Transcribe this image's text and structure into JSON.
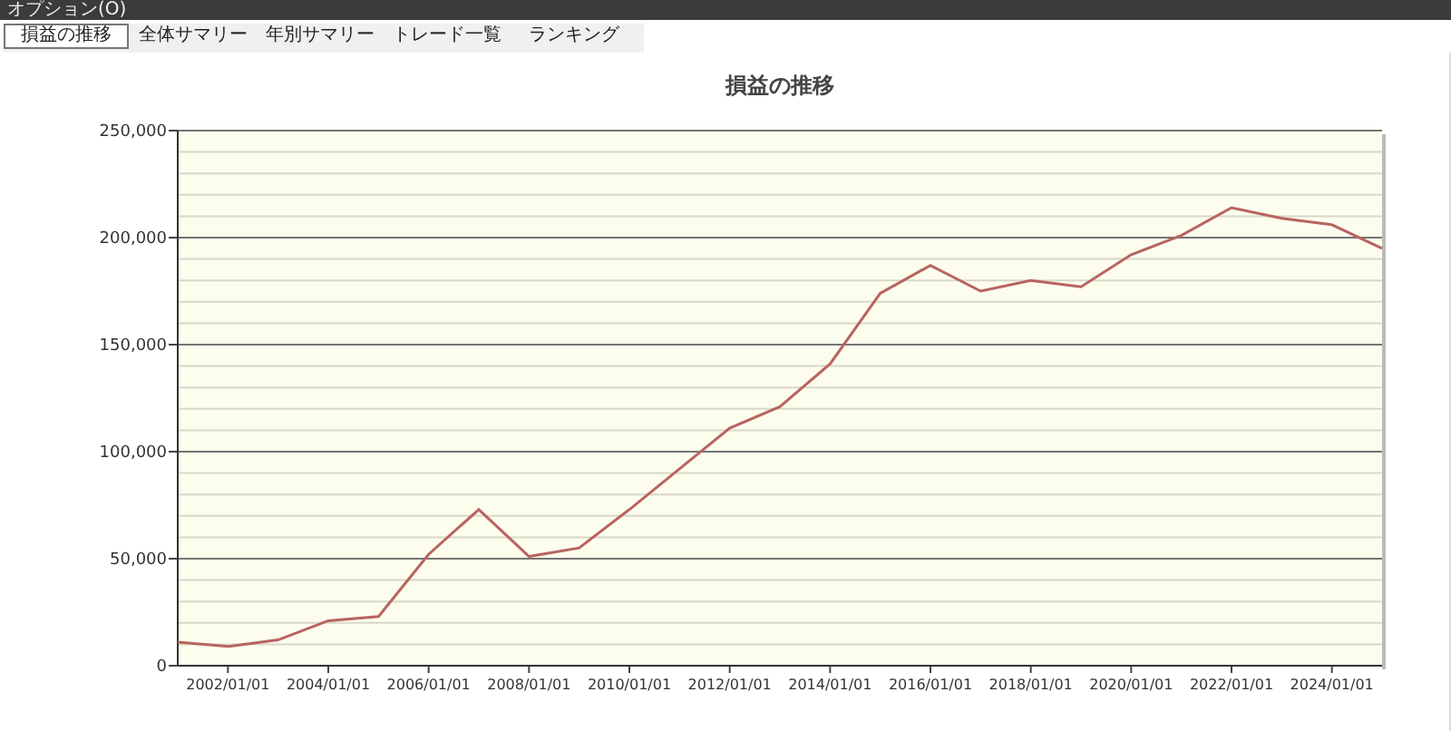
{
  "menu_bar": {
    "items": [
      "オプション(O)"
    ]
  },
  "tabs": [
    {
      "label": "損益の推移",
      "selected": true
    },
    {
      "label": "全体サマリー",
      "selected": false
    },
    {
      "label": "年別サマリー",
      "selected": false
    },
    {
      "label": "トレード一覧",
      "selected": false
    },
    {
      "label": "ランキング",
      "selected": false
    }
  ],
  "chart": {
    "chart_data": {
      "type": "line",
      "title": "損益の推移",
      "categories": [
        null,
        "2002/01/01",
        null,
        "2004/01/01",
        null,
        "2006/01/01",
        null,
        "2008/01/01",
        null,
        "2010/01/01",
        null,
        "2012/01/01",
        null,
        "2014/01/01",
        null,
        "2016/01/01",
        null,
        "2018/01/01",
        null,
        "2020/01/01",
        null,
        "2022/01/01",
        null,
        "2024/01/01",
        null
      ],
      "series": [
        {
          "color": "#b8645f",
          "values": [
            11000,
            9000,
            12000,
            21000,
            23000,
            52000,
            73000,
            51000,
            55000,
            73000,
            92000,
            111000,
            121000,
            141000,
            174000,
            187000,
            175000,
            180000,
            177000,
            192000,
            201000,
            214000,
            209000,
            206000,
            195000
          ]
        }
      ],
      "grid": true,
      "ylim": [
        0,
        250000
      ],
      "yticks": [
        {
          "value": 0,
          "label": "0"
        },
        {
          "value": 50000,
          "label": "50,000"
        },
        {
          "value": 100000,
          "label": "100,000"
        },
        {
          "value": 150000,
          "label": "150,000"
        },
        {
          "value": 200000,
          "label": "200,000"
        },
        {
          "value": 250000,
          "label": "250,000"
        }
      ]
    }
  }
}
